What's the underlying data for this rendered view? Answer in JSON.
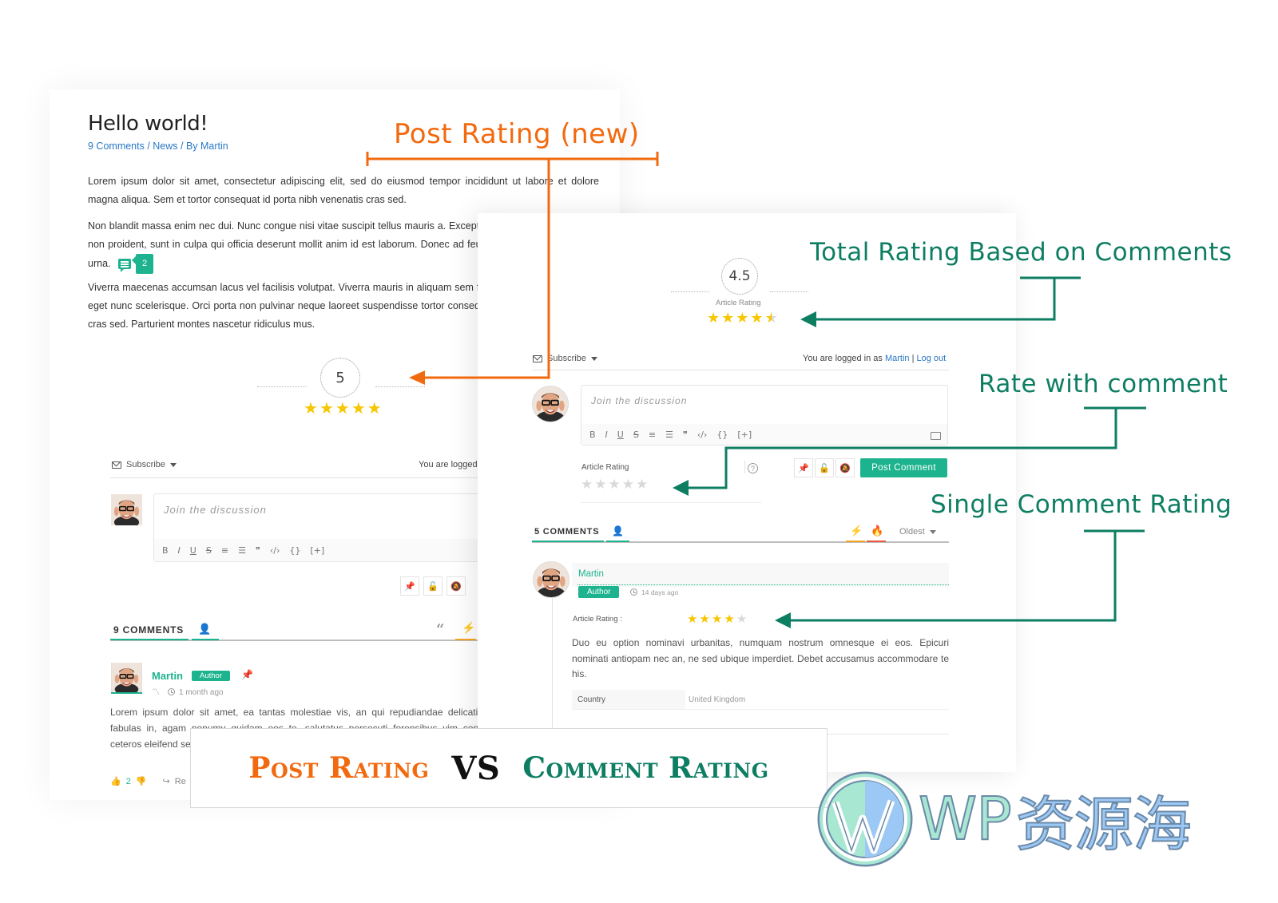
{
  "post": {
    "title": "Hello world!",
    "meta": "9 Comments / News / By Martin",
    "paragraphs": [
      "Lorem ipsum dolor sit amet, consectetur adipiscing elit, sed do eiusmod tempor incididunt ut labore et dolore magna aliqua.  Sem et tortor consequat id porta nibh venenatis cras sed.",
      "Non blandit massa enim nec dui. Nunc congue nisi vitae suscipit tellus mauris a. Excepteur sint occaecat cupidatat non proident, sunt in culpa qui officia deserunt mollit anim id est laborum. Donec ad feugiat in fermentum posuere urna.",
      "Viverra maecenas accumsan lacus vel facilisis volutpat. Viverra mauris in aliquam sem fringilla augue. Urna cursus eget nunc scelerisque. Orci porta non pulvinar neque laoreet suspendisse tortor consequat id porta nibh venenatis cras sed. Parturient montes nascetur ridiculus mus."
    ],
    "inline_comment_count": "2",
    "rating_value": "5",
    "rating_stars": 5,
    "subscribe_label": "Subscribe",
    "logged_in_partial": "You are logged",
    "editor_placeholder": "Join the discussion",
    "toolbar": [
      "B",
      "I",
      "U",
      "S",
      "≡",
      "☰",
      "❞",
      "‹/›",
      "{}",
      "[+]"
    ],
    "comments_tab": "9 COMMENTS",
    "comment": {
      "author": "Martin",
      "badge": "Author",
      "time": "1 month ago",
      "text": "Lorem ipsum dolor sit amet, ea tantas molestiae vis, an qui repudiandae delicatissimi equidem fabulas in, agam nonumy quidam eos te, salutatus persecuti forensibus vim contentiones nam ceteros eleifend sea",
      "upvotes": "2",
      "reply_partial": "Re"
    }
  },
  "comment_panel": {
    "total_rating": "4.5",
    "total_rating_label": "Article Rating",
    "total_rating_stars": 4.5,
    "subscribe_label": "Subscribe",
    "logged_in_prefix": "You are logged in as",
    "logged_in_user": "Martin",
    "separator": "|",
    "logout_label": "Log out",
    "editor_placeholder": "Join the discussion",
    "toolbar": [
      "B",
      "I",
      "U",
      "S",
      "≡",
      "☰",
      "❞",
      "‹/›",
      "{}",
      "[+]"
    ],
    "form_rating_label": "Article Rating",
    "form_rating_stars": 0,
    "post_comment_label": "Post Comment",
    "comments_tab": "5 COMMENTS",
    "sort_label": "Oldest",
    "comment": {
      "author": "Martin",
      "badge": "Author",
      "time": "14 days ago",
      "rating_label": "Article Rating :",
      "rating_stars": 4,
      "text": "Duo eu option nominavi urbanitas, numquam nostrum omnesque ei eos. Epicuri nominati antiopam nec an, ne sed ubique imperdiet. Debet accusamus accommodare te his.",
      "field_label": "Country",
      "field_value": "United Kingdom"
    }
  },
  "annotations": {
    "post_rating": "Post Rating (new)",
    "total_rating": "Total Rating Based on Comments",
    "rate_with_comment": "Rate with comment",
    "single_comment_rating": "Single Comment Rating",
    "orange": "#f26a10",
    "green": "#0e7e63"
  },
  "banner": {
    "left": "Post Rating",
    "middle": "VS",
    "right": "Comment Rating"
  },
  "watermark": {
    "latin": "WP",
    "cjk": "资源海"
  }
}
